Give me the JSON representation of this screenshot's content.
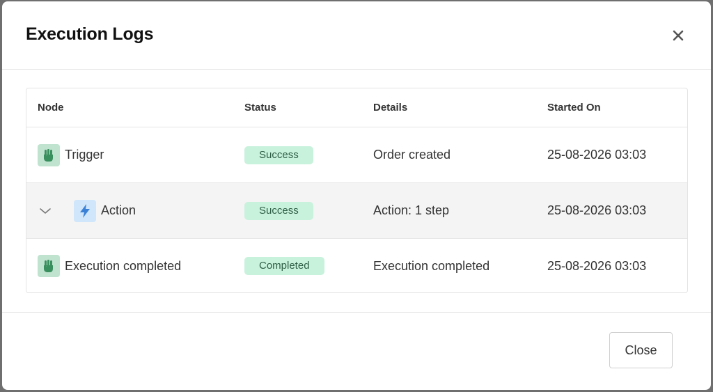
{
  "modal": {
    "title": "Execution Logs",
    "close_button_label": "Close"
  },
  "table": {
    "headers": {
      "node": "Node",
      "status": "Status",
      "details": "Details",
      "started_on": "Started On"
    },
    "rows": [
      {
        "node": "Trigger",
        "icon": "hand-pointer-icon",
        "status": "Success",
        "details": "Order created",
        "started_on": "25-08-2026 03:03"
      },
      {
        "node": "Action",
        "icon": "lightning-icon",
        "expandable": true,
        "status": "Success",
        "details": "Action: 1 step",
        "started_on": "25-08-2026 03:03"
      },
      {
        "node": "Execution completed",
        "icon": "hand-pointer-icon",
        "status": "Completed",
        "details": "Execution completed",
        "started_on": "25-08-2026 03:03"
      }
    ]
  },
  "colors": {
    "badge_background": "#c9f2dd",
    "badge_text": "#2e5e45",
    "node_icon_green": "#3a8f5e",
    "node_icon_blue": "#3b82d6",
    "selected_row_background": "#f4f4f4"
  }
}
